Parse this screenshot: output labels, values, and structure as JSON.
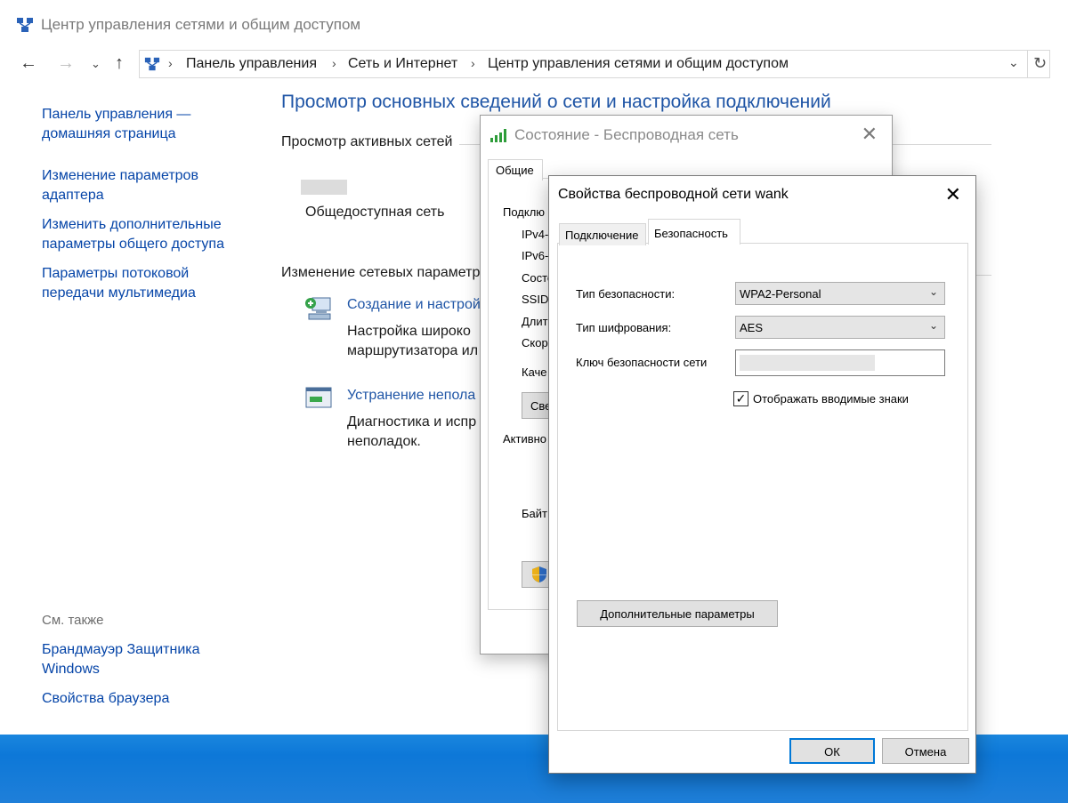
{
  "window": {
    "title": "Центр управления сетями и общим доступом"
  },
  "address": {
    "crumbs": [
      "Панель управления",
      "Сеть и Интернет",
      "Центр управления сетями и общим доступом"
    ]
  },
  "sidebar": {
    "links": [
      "Панель управления — домашняя страница",
      "Изменение параметров адаптера",
      "Изменить дополнительные параметры общего доступа",
      "Параметры потоковой передачи мультимедиа"
    ],
    "see_also_label": "См. также",
    "see_also": [
      "Брандмауэр Защитника Windows",
      "Свойства браузера"
    ]
  },
  "main": {
    "heading": "Просмотр основных сведений о сети и настройка подключений",
    "active_networks_heading": "Просмотр активных сетей",
    "network_type": "Общедоступная сеть",
    "change_settings_heading": "Изменение сетевых параметр",
    "tasks": [
      {
        "link": "Создание и настрой",
        "desc_line1": "Настройка широко",
        "desc_line2": "маршрутизатора ил",
        "icon": "network-setup-icon"
      },
      {
        "link": "Устранение непола",
        "desc_line1": "Диагностика и испр",
        "desc_line2": "неполадок.",
        "icon": "troubleshoot-icon"
      }
    ]
  },
  "status_dialog": {
    "title": "Состояние - Беспроводная сеть",
    "tab": "Общие",
    "labels": [
      "Подклю",
      "IPv4-",
      "IPv6-",
      "Состо",
      "SSID",
      "Длит",
      "Скор",
      "Каче"
    ],
    "button_partial": "Све",
    "activity_label": "Активно",
    "bytes_label": "Байт"
  },
  "props_dialog": {
    "title": "Свойства беспроводной сети wank",
    "tabs": [
      "Подключение",
      "Безопасность"
    ],
    "active_tab": "Безопасность",
    "security_type_label": "Тип безопасности:",
    "security_type_value": "WPA2-Personal",
    "encryption_type_label": "Тип шифрования:",
    "encryption_type_value": "AES",
    "key_label": "Ключ безопасности сети",
    "show_chars_label": "Отображать вводимые знаки",
    "show_chars_checked": true,
    "advanced_button": "Дополнительные параметры",
    "ok_button": "ОК",
    "cancel_button": "Отмена"
  },
  "colors": {
    "link": "#0645a8",
    "heading": "#1f55a6",
    "taskbar": "#0d78d8",
    "default_button_border": "#0078d7"
  }
}
